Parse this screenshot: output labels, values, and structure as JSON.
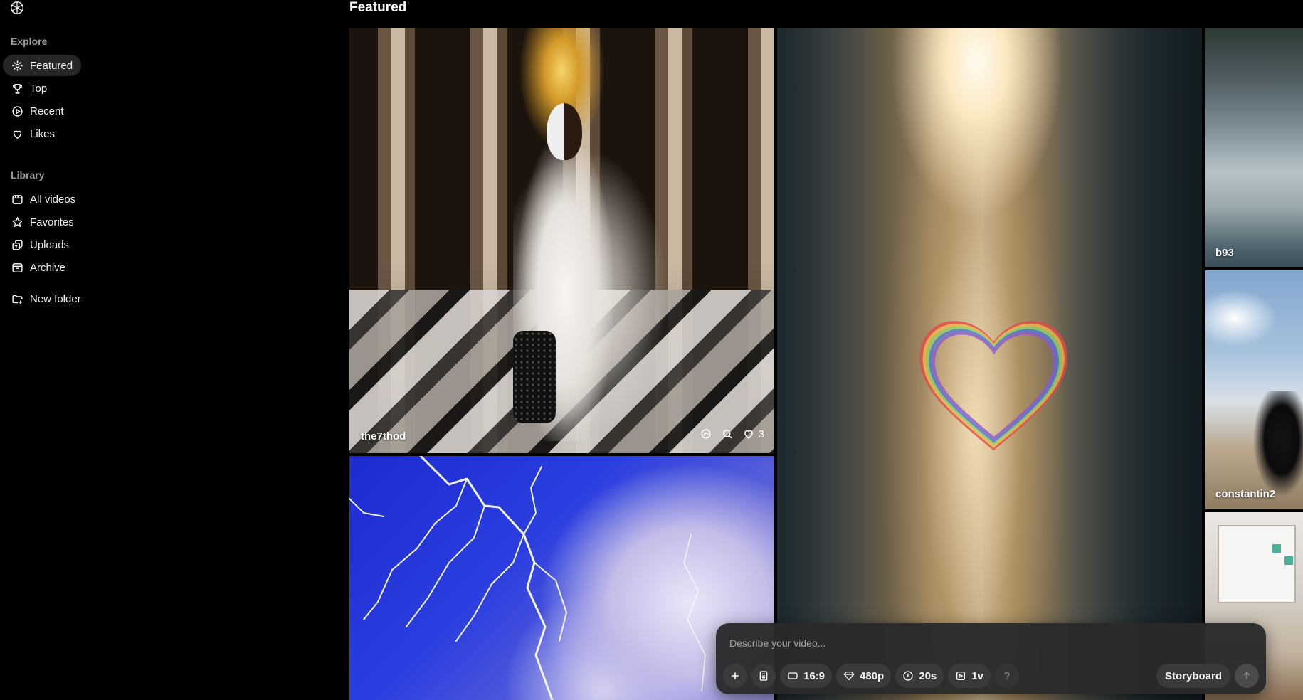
{
  "header": {
    "title": "Featured"
  },
  "sidebar": {
    "sections": [
      {
        "label": "Explore"
      },
      {
        "label": "Library"
      }
    ],
    "explore_items": [
      {
        "label": "Featured",
        "icon": "sparkles-icon",
        "active": true
      },
      {
        "label": "Top",
        "icon": "trophy-icon"
      },
      {
        "label": "Recent",
        "icon": "play-circle-icon"
      },
      {
        "label": "Likes",
        "icon": "heart-icon"
      }
    ],
    "library_items": [
      {
        "label": "All videos",
        "icon": "film-icon"
      },
      {
        "label": "Favorites",
        "icon": "star-icon"
      },
      {
        "label": "Uploads",
        "icon": "upload-icon"
      },
      {
        "label": "Archive",
        "icon": "archive-icon"
      }
    ],
    "new_folder": {
      "label": "New folder",
      "icon": "folder-plus-icon"
    }
  },
  "feed": {
    "tiles": [
      {
        "author": "the7thod",
        "likes": "3"
      },
      {
        "author": ""
      },
      {
        "author": ""
      },
      {
        "author": "b93"
      },
      {
        "author": "constantin2"
      },
      {
        "author": ""
      }
    ]
  },
  "composer": {
    "placeholder": "Describe your video...",
    "aspect_ratio": "16:9",
    "resolution": "480p",
    "duration": "20s",
    "variations": "1v",
    "help": "?",
    "storyboard_label": "Storyboard"
  }
}
